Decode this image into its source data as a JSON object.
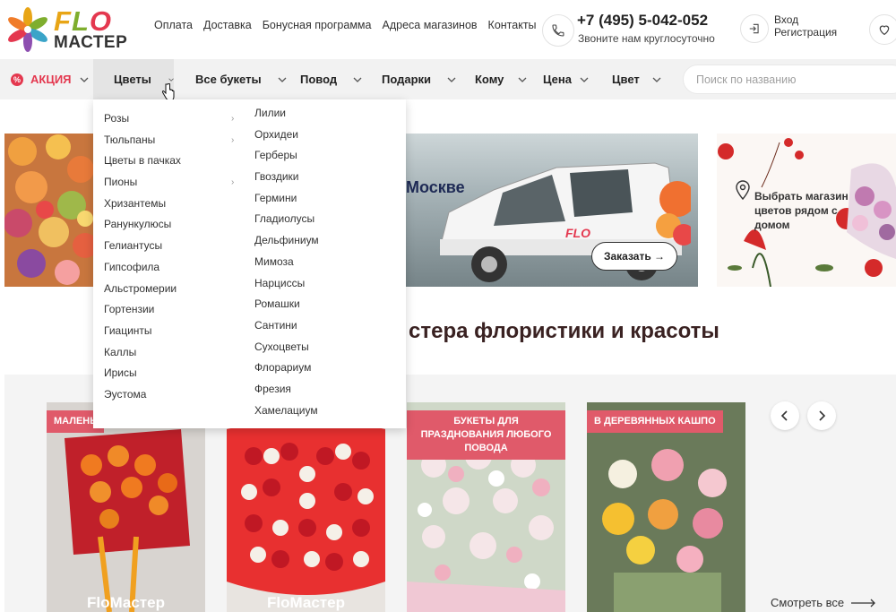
{
  "header": {
    "logo": {
      "flo_f": "F",
      "flo_l": "L",
      "flo_o": "O",
      "master": "МАСТЕР"
    },
    "links": [
      "Оплата",
      "Доставка",
      "Бонусная программа",
      "Адреса магазинов",
      "Контакты"
    ],
    "phone": "+7 (495) 5-042-052",
    "phone_note": "Звоните нам круглосуточно",
    "login": "Вход",
    "register": "Регистрация"
  },
  "nav": {
    "akcia": "АКЦИЯ",
    "items": [
      "Цветы",
      "Все букеты",
      "Повод",
      "Подарки",
      "Кому",
      "Цена",
      "Цвет"
    ],
    "search_placeholder": "Поиск по названию"
  },
  "dropdown": {
    "col1": [
      "Розы",
      "Тюльпаны",
      "Цветы в пачках",
      "Пионы",
      "Хризантемы",
      "Ранункулюсы",
      "Гелиантусы",
      "Гипсофила",
      "Альстромерии",
      "Гортензии",
      "Гиацинты",
      "Каллы",
      "Ирисы",
      "Эустома"
    ],
    "col1_arrows": [
      true,
      true,
      false,
      true
    ],
    "col2": [
      "Лилии",
      "Орхидеи",
      "Герберы",
      "Гвоздики",
      "Гермини",
      "Гладиолусы",
      "Дельфиниум",
      "Мимоза",
      "Нарциссы",
      "Ромашки",
      "Сантини",
      "Сухоцветы",
      "Флорариум",
      "Фрезия",
      "Хамелациум"
    ]
  },
  "banners": {
    "b2_title": "Москве",
    "order_button": "Заказать →",
    "b3_text": "Выбрать магазин цветов рядом с домом"
  },
  "section_title": "стера флористики и красоты",
  "cards": [
    {
      "badge": "МАЛЕНЬ",
      "brand": "FloМастер"
    },
    {
      "badge": "",
      "brand": "FloМастер"
    },
    {
      "badge": "БУКЕТЫ ДЛЯ ПРАЗДНОВАНИЯ ЛЮБОГО ПОВОДА",
      "brand": ""
    },
    {
      "badge": "В ДЕРЕВЯННЫХ КАШПО",
      "brand": ""
    }
  ],
  "see_all": "Смотреть все",
  "colors": {
    "accent": "#e4384f",
    "badge": "#e05a6a",
    "nav_bg": "#f2f2f2"
  }
}
